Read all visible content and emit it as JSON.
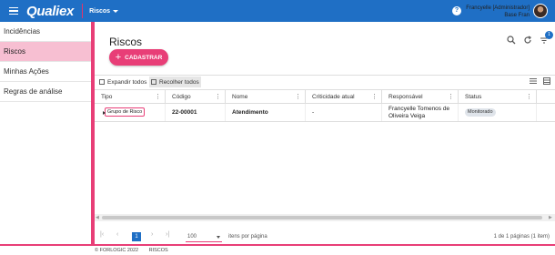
{
  "header": {
    "logo": "Qualiex",
    "module": "Riscos",
    "user_name": "Francyelle [Administrador]",
    "user_base": "Base Fran",
    "help_label": "?"
  },
  "sidebar": {
    "items": [
      {
        "label": "Incidências"
      },
      {
        "label": "Riscos"
      },
      {
        "label": "Minhas Ações"
      },
      {
        "label": "Regras de análise"
      }
    ]
  },
  "page": {
    "title": "Riscos",
    "create_label": "CADASTRAR",
    "filter_badge": "1"
  },
  "toolbar": {
    "expand_label": "Expandir todos",
    "collapse_label": "Recolher todos"
  },
  "table": {
    "columns": [
      "Tipo",
      "Código",
      "Nome",
      "Criticidade atual",
      "Responsável",
      "Status"
    ],
    "rows": [
      {
        "tipo": "Grupo de Risco",
        "codigo": "22-00001",
        "nome": "Atendimento",
        "criticidade": "-",
        "responsavel_1": "Francyelle Tomenos de",
        "responsavel_2": "Oliveira Veiga",
        "status": "Monitorado"
      }
    ]
  },
  "pager": {
    "current_page": "1",
    "page_size": "100",
    "page_size_label": "itens por página",
    "info": "1 de 1 páginas (1 item)"
  },
  "footer": {
    "copyright": "© FORLOGIC 2022",
    "module": "RISCOS"
  }
}
